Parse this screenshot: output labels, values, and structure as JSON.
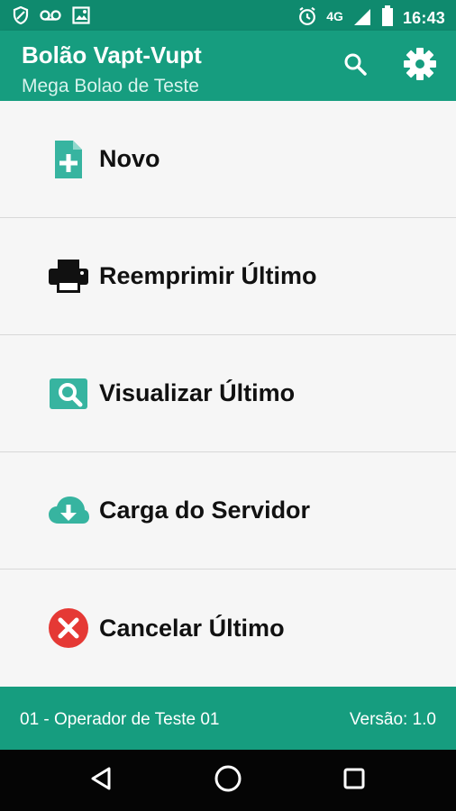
{
  "status_bar": {
    "time": "16:43",
    "network": "4G",
    "icons": [
      "shield-icon",
      "voicemail-icon",
      "image-icon",
      "alarm-icon",
      "signal-icon",
      "battery-icon"
    ]
  },
  "app_bar": {
    "title": "Bolão Vapt-Vupt",
    "subtitle": "Mega Bolao de Teste",
    "actions": [
      "search-icon",
      "gear-icon"
    ],
    "color": "#169d7f"
  },
  "menu": {
    "items": [
      {
        "label": "Novo",
        "icon": "new-document-icon"
      },
      {
        "label": "Reemprimir Último",
        "icon": "printer-icon"
      },
      {
        "label": "Visualizar Último",
        "icon": "search-icon"
      },
      {
        "label": "Carga do Servidor",
        "icon": "cloud-download-icon"
      },
      {
        "label": "Cancelar Último",
        "icon": "cancel-icon"
      }
    ]
  },
  "footer": {
    "operator": "01 - Operador de Teste 01",
    "version": "Versão: 1.0"
  },
  "navigation": {
    "buttons": [
      "back-icon",
      "home-icon",
      "recent-apps-icon"
    ]
  },
  "colors": {
    "accent": "#169d7f",
    "status_bar": "#0f8a6e",
    "danger": "#e53935",
    "icon_teal": "#37b4a0"
  }
}
